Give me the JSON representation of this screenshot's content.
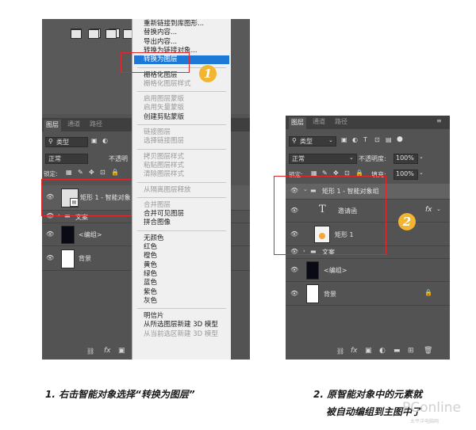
{
  "left": {
    "tabs": [
      "图层",
      "通道",
      "路径"
    ],
    "filter_label": "类型",
    "blend_mode": "正常",
    "opacity_label": "不透明",
    "lock_label": "锁定:",
    "layers": [
      {
        "name": "矩形 1 - 智能对象"
      },
      {
        "name": "文案"
      },
      {
        "name": "<编组>"
      },
      {
        "name": "背景"
      }
    ],
    "bottom_fx": "fx",
    "menu": {
      "groups": [
        [
          {
            "label": "重新链接到库图形..."
          },
          {
            "label": "替换内容..."
          },
          {
            "label": "导出内容..."
          },
          {
            "label": "转换为链接对象..."
          },
          {
            "label": "转换为图层",
            "highlight": true
          }
        ],
        [
          {
            "label": "栅格化图层"
          },
          {
            "label": "栅格化图层样式",
            "disabled": true
          }
        ],
        [
          {
            "label": "启用图层蒙版",
            "disabled": true
          },
          {
            "label": "启用矢量蒙版",
            "disabled": true
          },
          {
            "label": "创建剪贴蒙版"
          }
        ],
        [
          {
            "label": "链接图层",
            "disabled": true
          },
          {
            "label": "选择链接图层",
            "disabled": true
          }
        ],
        [
          {
            "label": "拷贝图层样式",
            "disabled": true
          },
          {
            "label": "粘贴图层样式",
            "disabled": true
          },
          {
            "label": "清除图层样式",
            "disabled": true
          }
        ],
        [
          {
            "label": "从隔离图层释放",
            "disabled": true
          }
        ],
        [
          {
            "label": "合并图层",
            "disabled": true
          },
          {
            "label": "合并可见图层"
          },
          {
            "label": "拼合图像"
          }
        ],
        [
          {
            "label": "无颜色"
          },
          {
            "label": "红色"
          },
          {
            "label": "橙色"
          },
          {
            "label": "黄色"
          },
          {
            "label": "绿色"
          },
          {
            "label": "蓝色"
          },
          {
            "label": "紫色"
          },
          {
            "label": "灰色"
          }
        ],
        [
          {
            "label": "明信片"
          },
          {
            "label": "从所选图层新建 3D 模型"
          },
          {
            "label": "从当前选区新建 3D 模型",
            "disabled": true
          }
        ]
      ]
    },
    "badge": "1"
  },
  "right": {
    "tabs": [
      "图层",
      "通道",
      "路径"
    ],
    "filter_label": "类型",
    "blend_mode": "正常",
    "opacity_label": "不透明度:",
    "opacity_value": "100%",
    "lock_label": "锁定:",
    "fill_label": "填充:",
    "fill_value": "100%",
    "layers": [
      {
        "name": "矩形 1 - 智能对象组"
      },
      {
        "name": "邀请函",
        "fx": "fx"
      },
      {
        "name": "矩形 1"
      },
      {
        "name": "文案"
      },
      {
        "name": "<编组>"
      },
      {
        "name": "背景"
      }
    ],
    "text_layer_glyph": "T",
    "bottom_fx": "fx",
    "badge": "2"
  },
  "captions": {
    "left": "1. 右击智能对象选择“转换为图层”",
    "right_line1": "2. 原智能对象中的元素就",
    "right_line2": "被自动编组到主图中了"
  },
  "watermark": {
    "brand": "PConline",
    "sub": "太平洋电脑网"
  },
  "colors": {
    "panel": "#535353",
    "highlight": "#1e78d6",
    "callout_red": "#e5262b",
    "badge": "#f2b531"
  }
}
